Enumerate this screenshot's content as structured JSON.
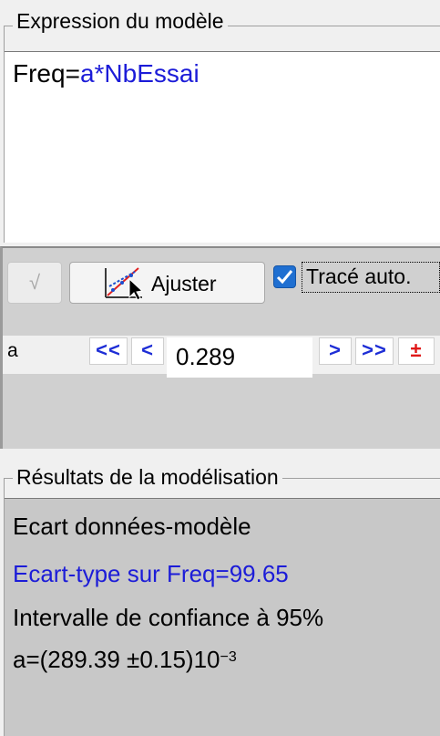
{
  "model_group": {
    "title": "Expression du modèle",
    "expression_var": "Freq=",
    "expression_formula": "a*NbEssai"
  },
  "toolbar": {
    "check_glyph": "√",
    "fit_label": "Ajuster",
    "auto_plot_label": "Tracé auto.",
    "auto_plot_checked": true
  },
  "parameter": {
    "name": "a",
    "fast_down_label": "<<",
    "down_label": "<",
    "value": "0.289",
    "up_label": ">",
    "fast_up_label": ">>",
    "plusminus_label": "±"
  },
  "results_group": {
    "title": "Résultats de la modélisation",
    "line1": "Ecart données-modèle",
    "line2": "Ecart-type sur Freq=99.65",
    "line3": "Intervalle de confiance à 95%",
    "line4_main": "a=(289.39 ±0.15)10",
    "line4_exp": "−3"
  },
  "colors": {
    "formula_blue": "#1c1cd8",
    "nav_blue": "#1e2ed6",
    "plusminus_red": "#e01818",
    "checkbox_blue": "#1f6fd1"
  },
  "icons": {
    "fit": "fit-curve-icon",
    "check": "checkmark-icon"
  }
}
